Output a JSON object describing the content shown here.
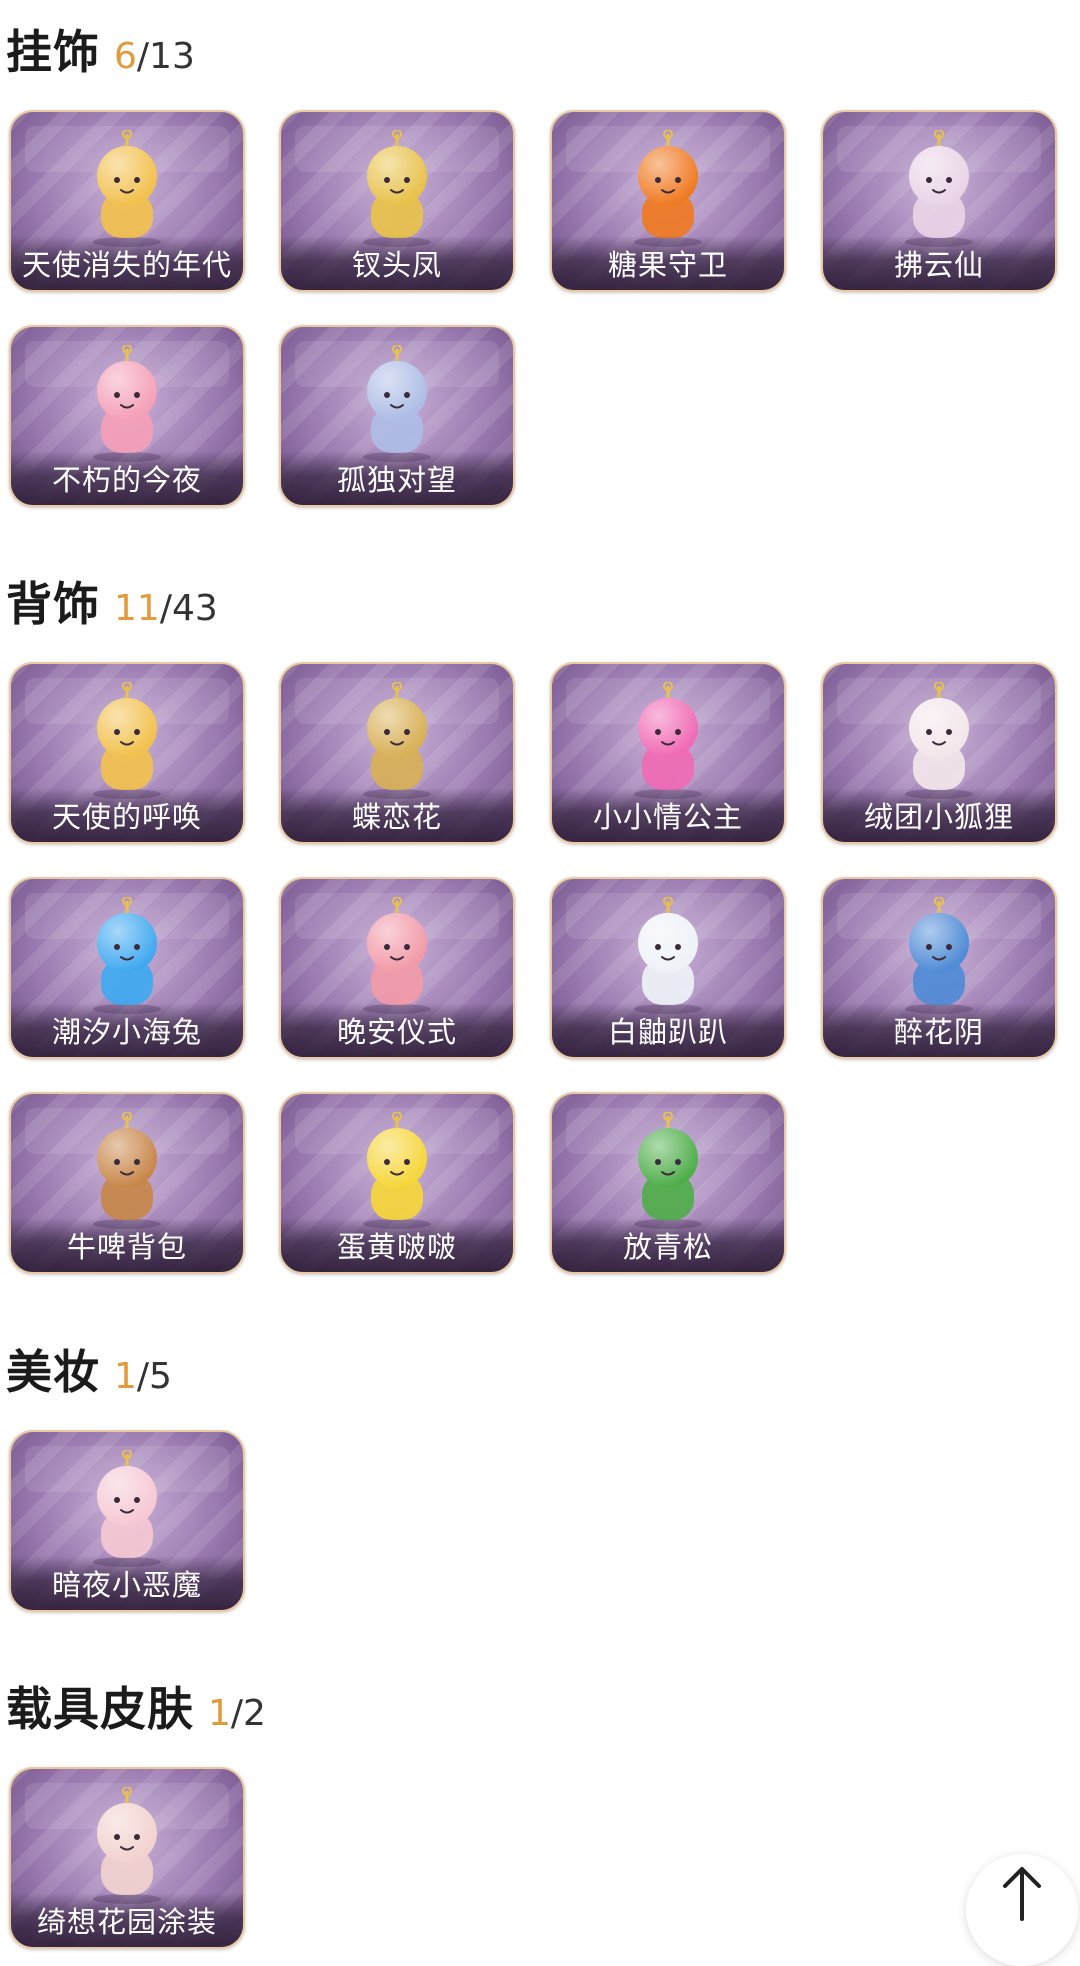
{
  "sections": [
    {
      "title": "挂饰",
      "owned": "6",
      "total": "/13",
      "items": [
        {
          "name": "天使消失的年代",
          "icon": "angel-halo-girl-icon",
          "accent": "#f2c14e"
        },
        {
          "name": "钗头凤",
          "icon": "phoenix-crown-icon",
          "accent": "#e8c24a"
        },
        {
          "name": "糖果守卫",
          "icon": "pumpkin-candy-icon",
          "accent": "#f07a22"
        },
        {
          "name": "拂云仙",
          "icon": "cloud-fairy-icon",
          "accent": "#e9d4e6"
        },
        {
          "name": "不朽的今夜",
          "icon": "pink-fox-cupcake-icon",
          "accent": "#f4a0b8"
        },
        {
          "name": "孤独对望",
          "icon": "blue-hair-doll-icon",
          "accent": "#aebde6"
        }
      ]
    },
    {
      "title": "背饰",
      "owned": "11",
      "total": "/43",
      "items": [
        {
          "name": "天使的呼唤",
          "icon": "cherub-icon",
          "accent": "#f2c14e"
        },
        {
          "name": "蝶恋花",
          "icon": "butterfly-bell-icon",
          "accent": "#d8b056"
        },
        {
          "name": "小小情公主",
          "icon": "pink-princess-icon",
          "accent": "#f06ab4"
        },
        {
          "name": "绒团小狐狸",
          "icon": "white-fox-icon",
          "accent": "#f3e6ea"
        },
        {
          "name": "潮汐小海兔",
          "icon": "blue-sea-bunny-icon",
          "accent": "#3fa9f0"
        },
        {
          "name": "晚安仪式",
          "icon": "pink-bear-icon",
          "accent": "#f29aa8"
        },
        {
          "name": "白鼬趴趴",
          "icon": "white-ferret-icon",
          "accent": "#eef2f7"
        },
        {
          "name": "醉花阴",
          "icon": "flower-mirror-icon",
          "accent": "#4f8bd6"
        },
        {
          "name": "牛啤背包",
          "icon": "cow-beer-barrel-icon",
          "accent": "#c8874a"
        },
        {
          "name": "蛋黄啵啵",
          "icon": "yellow-chick-egg-icon",
          "accent": "#f6d63a"
        },
        {
          "name": "放青松",
          "icon": "bonsai-pine-icon",
          "accent": "#4fae4a"
        }
      ]
    },
    {
      "title": "美妆",
      "owned": "1",
      "total": "/5",
      "items": [
        {
          "name": "暗夜小恶魔",
          "icon": "little-devil-icon",
          "accent": "#f6c8d4"
        }
      ]
    },
    {
      "title": "载具皮肤",
      "owned": "1",
      "total": "/2",
      "items": [
        {
          "name": "绮想花园涂装",
          "icon": "garden-van-icon",
          "accent": "#f2d2cf"
        }
      ]
    }
  ],
  "scroll_top": {
    "icon": "arrow-up-icon"
  },
  "colors": {
    "owned_count": "#e39a3c",
    "card_border": "#e9c9a0",
    "title": "#1b1b1b"
  }
}
